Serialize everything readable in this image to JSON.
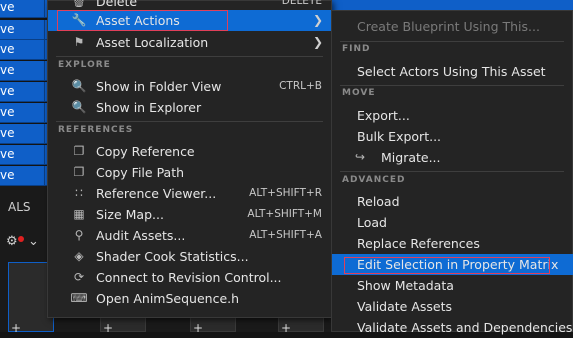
{
  "background": {
    "row_label": "ve",
    "row_count": 9,
    "tab_label": "ALS"
  },
  "menu": {
    "items": [
      {
        "label": "Delete",
        "shortcut": "DELETE",
        "icon": "trash-icon"
      },
      {
        "label": "Asset Actions",
        "icon": "wrench-icon",
        "submenu": true
      },
      {
        "label": "Asset Localization",
        "icon": "flag-icon",
        "submenu": true
      }
    ],
    "sections": {
      "explore": "EXPLORE",
      "references": "REFERENCES"
    },
    "explore_items": [
      {
        "label": "Show in Folder View",
        "shortcut": "CTRL+B",
        "icon": "folder-search-icon"
      },
      {
        "label": "Show in Explorer",
        "icon": "folder-search-icon"
      }
    ],
    "reference_items": [
      {
        "label": "Copy Reference",
        "icon": "copy-icon"
      },
      {
        "label": "Copy File Path",
        "icon": "copy-icon"
      },
      {
        "label": "Reference Viewer...",
        "shortcut": "ALT+SHIFT+R",
        "icon": "node-graph-icon"
      },
      {
        "label": "Size Map...",
        "shortcut": "ALT+SHIFT+M",
        "icon": "grid-icon"
      },
      {
        "label": "Audit Assets...",
        "shortcut": "ALT+SHIFT+A",
        "icon": "audit-icon"
      },
      {
        "label": "Shader Cook Statistics...",
        "icon": "shader-icon"
      },
      {
        "label": "Connect to Revision Control...",
        "icon": "revision-icon"
      },
      {
        "label": "Open AnimSequence.h",
        "icon": "code-icon"
      }
    ]
  },
  "submenu": {
    "top_item": "Create Blueprint Using This...",
    "sections": {
      "find": "FIND",
      "move": "MOVE",
      "advanced": "ADVANCED"
    },
    "find_items": [
      "Select Actors Using This Asset"
    ],
    "move_items": [
      "Export...",
      "Bulk Export...",
      "Migrate..."
    ],
    "advanced_items": [
      "Reload",
      "Load",
      "Replace References",
      "Edit Selection in Property Matrix",
      "Show Metadata",
      "Validate Assets",
      "Validate Assets and Dependencies"
    ]
  },
  "colors": {
    "highlight": "#0e6bd4",
    "menu_bg": "#242424",
    "row_bg": "#0f5fc8",
    "annotation_frame": "#e0405a"
  }
}
